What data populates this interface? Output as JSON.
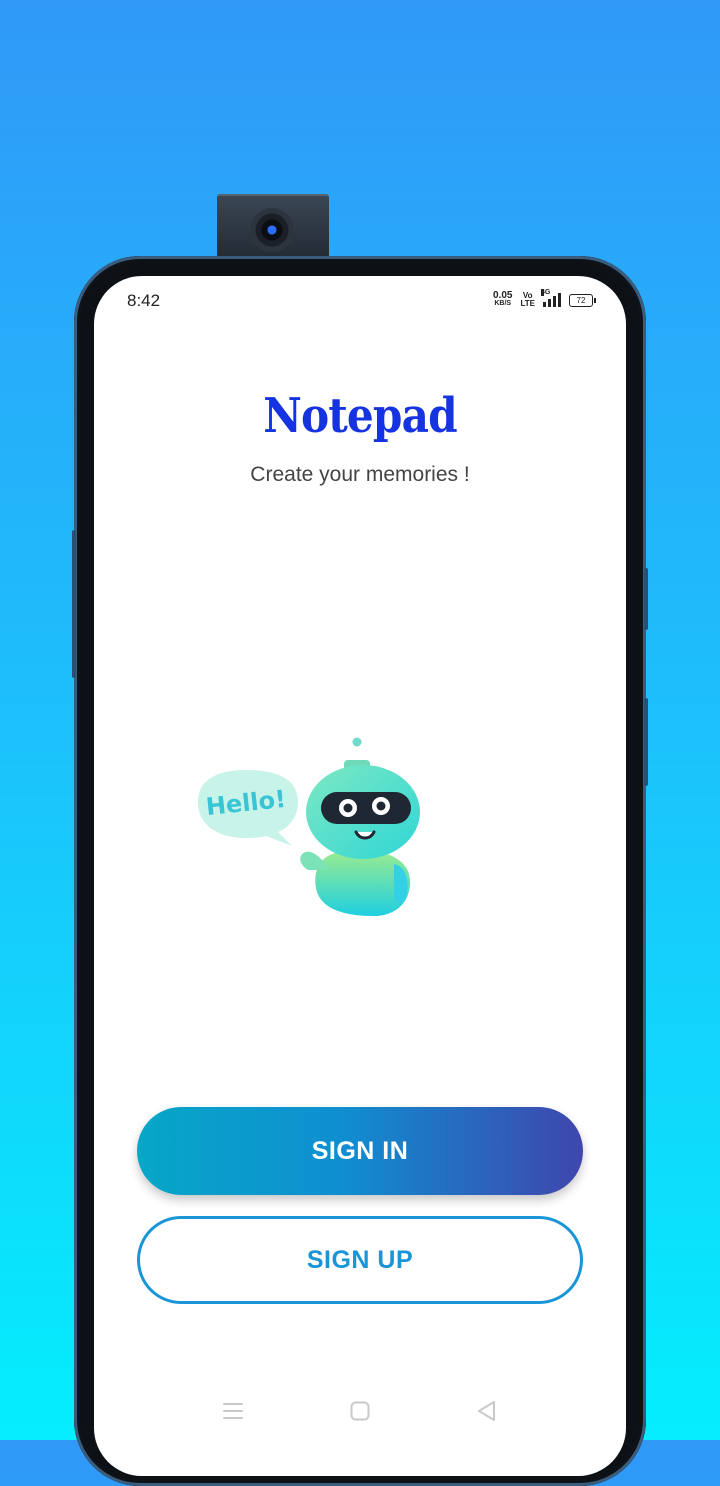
{
  "status_bar": {
    "time": "8:42",
    "net_speed_value": "0.05",
    "net_speed_unit": "KB/S",
    "volte_top": "Vo",
    "volte_bottom": "LTE",
    "network_type": "4G",
    "battery": "72"
  },
  "app": {
    "title": "Notepad",
    "subtitle": "Create your memories !"
  },
  "illustration": {
    "speech_bubble_text": "Hello!"
  },
  "buttons": {
    "sign_in": "SIGN IN",
    "sign_up": "SIGN UP"
  },
  "nav_bar": {
    "items": [
      "menu-icon",
      "home-icon",
      "back-icon"
    ]
  },
  "colors": {
    "background_top": "#3099f8",
    "background_bottom": "#04eefd",
    "title": "#1533e0",
    "accent": "#1a95d8",
    "sign_in_gradient_start": "#07a7c6",
    "sign_in_gradient_end": "#3f46ad"
  }
}
